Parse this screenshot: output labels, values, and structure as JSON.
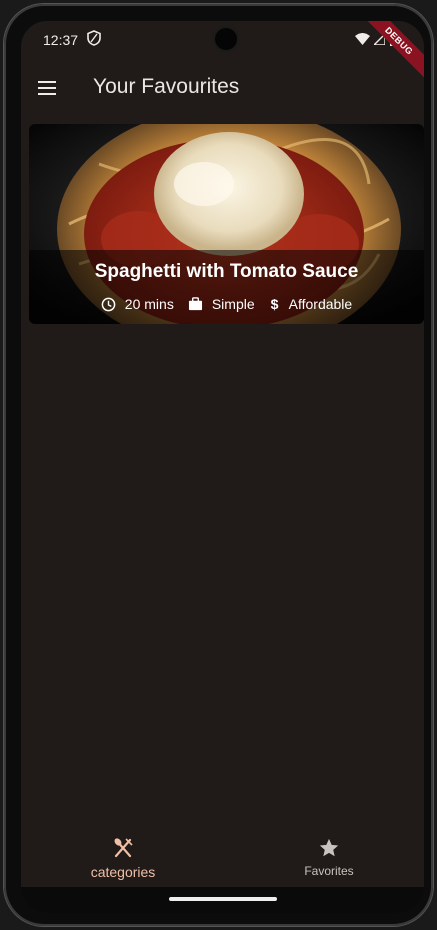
{
  "status_bar": {
    "time": "12:37",
    "debug_label": "DEBUG"
  },
  "app_bar": {
    "title": "Your Favourites",
    "menu_icon": "hamburger-menu-icon"
  },
  "favorites": [
    {
      "title": "Spaghetti with Tomato Sauce",
      "duration": "20 mins",
      "complexity": "Simple",
      "affordability": "Affordable",
      "image_icon": "spaghetti-photo"
    }
  ],
  "bottom_nav": {
    "items": [
      {
        "label": "categories",
        "icon": "fork-knife-icon",
        "selected": true
      },
      {
        "label": "Favorites",
        "icon": "star-icon",
        "selected": false
      }
    ]
  },
  "colors": {
    "background": "#201b18",
    "accent": "#f1bfa8",
    "debug": "#8b1220"
  }
}
